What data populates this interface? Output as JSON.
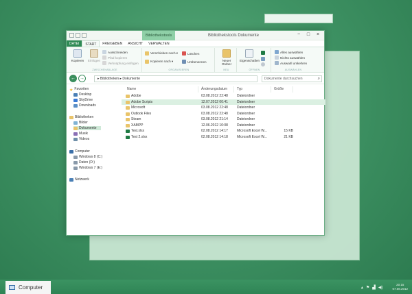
{
  "window": {
    "title": "Bibliothekstools Dokumente",
    "context_tab": "Bibliothekstools",
    "controls": {
      "minimize": "−",
      "maximize": "□",
      "close": "×"
    }
  },
  "ribbon_tabs": [
    "DATEI",
    "START",
    "FREIGEBEN",
    "ANSICHT",
    "VERWALTEN"
  ],
  "ribbon": {
    "clipboard": {
      "copy": "Kopieren",
      "paste": "Einfügen",
      "cut": "Ausschneiden",
      "copy_path": "Pfad kopieren",
      "paste_shortcut": "Verknüpfung einfügen",
      "label": "ZWISCHENABLAGE"
    },
    "organize": {
      "move_to": "Verschieben nach ▾",
      "copy_to": "Kopieren nach ▾",
      "delete": "Löschen",
      "rename": "Umbenennen",
      "label": "ORGANISIEREN"
    },
    "new": {
      "new_folder": "Neuer Ordner",
      "label": "NEU"
    },
    "open": {
      "properties": "Eigenschaften",
      "label": "ÖFFNEN"
    },
    "select": {
      "select_all": "Alles auswählen",
      "select_none": "Nichts auswählen",
      "invert": "Auswahl umkehren",
      "label": "AUSWÄHLEN"
    }
  },
  "nav": {
    "back": "←",
    "forward": "→",
    "address": "▸ Bibliotheken ▸ Dokumente",
    "search_placeholder": "Dokumente durchsuchen"
  },
  "sidebar": {
    "favorites": "Favoriten",
    "desktop": "Desktop",
    "skydrive": "SkyDrive",
    "downloads": "Downloads",
    "libraries": "Bibliotheken",
    "pictures": "Bilder",
    "documents": "Dokumente",
    "music": "Musik",
    "videos": "Videos",
    "computer": "Computer",
    "drive_c": "Windows 8 (C:)",
    "drive_d": "Daten (D:)",
    "drive_e": "Windows 7 (E:)",
    "network": "Netzwerk"
  },
  "columns": {
    "name": "Name",
    "date": "Änderungsdatum",
    "type": "Typ",
    "size": "Größe"
  },
  "files": [
    {
      "name": "Adobe",
      "date": "03.08.2012 22:48",
      "type": "Dateiordner",
      "size": ""
    },
    {
      "name": "Adobe Scripts",
      "date": "12.07.2012 00:41",
      "type": "Dateiordner",
      "size": ""
    },
    {
      "name": "Microsoft",
      "date": "03.08.2012 22:48",
      "type": "Dateiordner",
      "size": ""
    },
    {
      "name": "Outlook Files",
      "date": "03.08.2012 22:48",
      "type": "Dateiordner",
      "size": ""
    },
    {
      "name": "Steam",
      "date": "03.08.2012 21:14",
      "type": "Dateiordner",
      "size": ""
    },
    {
      "name": "XAMPP",
      "date": "12.06.2012 10:08",
      "type": "Dateiordner",
      "size": ""
    },
    {
      "name": "Test.xlsx",
      "date": "02.08.2012 14:17",
      "type": "Microsoft Excel W...",
      "size": "15 KB"
    },
    {
      "name": "Test 2.xlsx",
      "date": "02.08.2012 14:18",
      "type": "Microsoft Excel W...",
      "size": "21 KB"
    }
  ],
  "taskbar": {
    "app_label": "Computer",
    "time": "20:15",
    "date": "07.08.2012"
  },
  "colors": {
    "accent": "#2f8a55",
    "selection": "#dbf0e2",
    "folder": "#e9c46a",
    "excel": "#1f7a44"
  }
}
